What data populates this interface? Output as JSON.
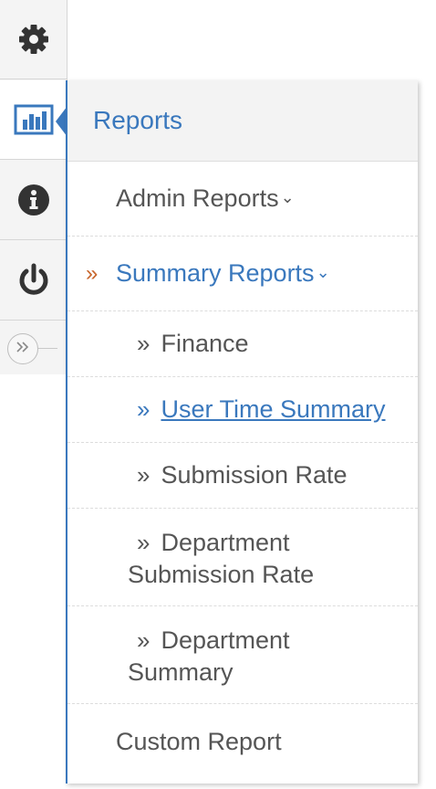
{
  "rail": {
    "items": [
      {
        "name": "settings",
        "icon": "gear-icon"
      },
      {
        "name": "reports",
        "icon": "bar-chart-icon",
        "active": true
      },
      {
        "name": "info",
        "icon": "info-icon"
      },
      {
        "name": "power",
        "icon": "power-icon"
      }
    ],
    "collapse_icon": "double-chevron-right-icon"
  },
  "menu": {
    "header": "Reports",
    "admin_reports": "Admin Reports",
    "summary_reports": "Summary Reports",
    "chevron": "⌄",
    "prefix": "»",
    "sub_items": {
      "finance": "Finance",
      "user_time_summary": "User Time Summary",
      "submission_rate": "Submission Rate",
      "dept_submission_rate_1": "Department",
      "dept_submission_rate_2": "Submission Rate",
      "dept_summary_1": "Department",
      "dept_summary_2": "Summary"
    },
    "custom_report": "Custom Report"
  },
  "colors": {
    "accent": "#3a78bd",
    "prefix_orange": "#c8662d",
    "text": "#555555",
    "icon": "#333333"
  }
}
